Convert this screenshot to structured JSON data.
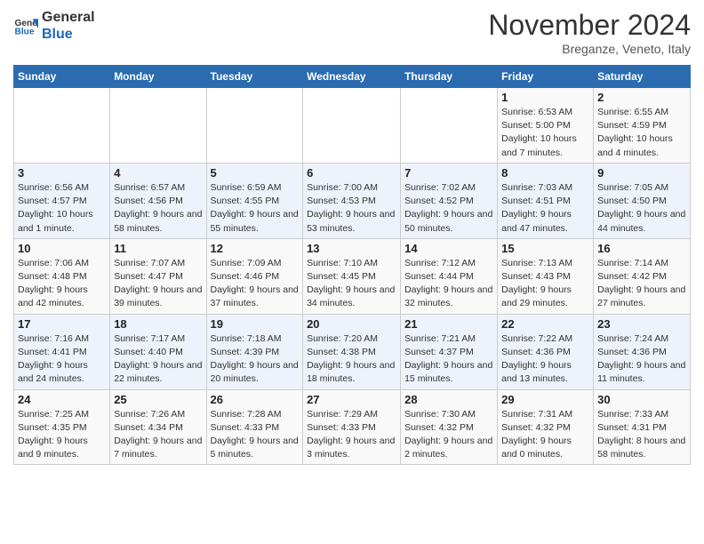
{
  "header": {
    "logo_line1": "General",
    "logo_line2": "Blue",
    "month": "November 2024",
    "location": "Breganze, Veneto, Italy"
  },
  "days_of_week": [
    "Sunday",
    "Monday",
    "Tuesday",
    "Wednesday",
    "Thursday",
    "Friday",
    "Saturday"
  ],
  "weeks": [
    [
      {
        "day": "",
        "info": ""
      },
      {
        "day": "",
        "info": ""
      },
      {
        "day": "",
        "info": ""
      },
      {
        "day": "",
        "info": ""
      },
      {
        "day": "",
        "info": ""
      },
      {
        "day": "1",
        "info": "Sunrise: 6:53 AM\nSunset: 5:00 PM\nDaylight: 10 hours and 7 minutes."
      },
      {
        "day": "2",
        "info": "Sunrise: 6:55 AM\nSunset: 4:59 PM\nDaylight: 10 hours and 4 minutes."
      }
    ],
    [
      {
        "day": "3",
        "info": "Sunrise: 6:56 AM\nSunset: 4:57 PM\nDaylight: 10 hours and 1 minute."
      },
      {
        "day": "4",
        "info": "Sunrise: 6:57 AM\nSunset: 4:56 PM\nDaylight: 9 hours and 58 minutes."
      },
      {
        "day": "5",
        "info": "Sunrise: 6:59 AM\nSunset: 4:55 PM\nDaylight: 9 hours and 55 minutes."
      },
      {
        "day": "6",
        "info": "Sunrise: 7:00 AM\nSunset: 4:53 PM\nDaylight: 9 hours and 53 minutes."
      },
      {
        "day": "7",
        "info": "Sunrise: 7:02 AM\nSunset: 4:52 PM\nDaylight: 9 hours and 50 minutes."
      },
      {
        "day": "8",
        "info": "Sunrise: 7:03 AM\nSunset: 4:51 PM\nDaylight: 9 hours and 47 minutes."
      },
      {
        "day": "9",
        "info": "Sunrise: 7:05 AM\nSunset: 4:50 PM\nDaylight: 9 hours and 44 minutes."
      }
    ],
    [
      {
        "day": "10",
        "info": "Sunrise: 7:06 AM\nSunset: 4:48 PM\nDaylight: 9 hours and 42 minutes."
      },
      {
        "day": "11",
        "info": "Sunrise: 7:07 AM\nSunset: 4:47 PM\nDaylight: 9 hours and 39 minutes."
      },
      {
        "day": "12",
        "info": "Sunrise: 7:09 AM\nSunset: 4:46 PM\nDaylight: 9 hours and 37 minutes."
      },
      {
        "day": "13",
        "info": "Sunrise: 7:10 AM\nSunset: 4:45 PM\nDaylight: 9 hours and 34 minutes."
      },
      {
        "day": "14",
        "info": "Sunrise: 7:12 AM\nSunset: 4:44 PM\nDaylight: 9 hours and 32 minutes."
      },
      {
        "day": "15",
        "info": "Sunrise: 7:13 AM\nSunset: 4:43 PM\nDaylight: 9 hours and 29 minutes."
      },
      {
        "day": "16",
        "info": "Sunrise: 7:14 AM\nSunset: 4:42 PM\nDaylight: 9 hours and 27 minutes."
      }
    ],
    [
      {
        "day": "17",
        "info": "Sunrise: 7:16 AM\nSunset: 4:41 PM\nDaylight: 9 hours and 24 minutes."
      },
      {
        "day": "18",
        "info": "Sunrise: 7:17 AM\nSunset: 4:40 PM\nDaylight: 9 hours and 22 minutes."
      },
      {
        "day": "19",
        "info": "Sunrise: 7:18 AM\nSunset: 4:39 PM\nDaylight: 9 hours and 20 minutes."
      },
      {
        "day": "20",
        "info": "Sunrise: 7:20 AM\nSunset: 4:38 PM\nDaylight: 9 hours and 18 minutes."
      },
      {
        "day": "21",
        "info": "Sunrise: 7:21 AM\nSunset: 4:37 PM\nDaylight: 9 hours and 15 minutes."
      },
      {
        "day": "22",
        "info": "Sunrise: 7:22 AM\nSunset: 4:36 PM\nDaylight: 9 hours and 13 minutes."
      },
      {
        "day": "23",
        "info": "Sunrise: 7:24 AM\nSunset: 4:36 PM\nDaylight: 9 hours and 11 minutes."
      }
    ],
    [
      {
        "day": "24",
        "info": "Sunrise: 7:25 AM\nSunset: 4:35 PM\nDaylight: 9 hours and 9 minutes."
      },
      {
        "day": "25",
        "info": "Sunrise: 7:26 AM\nSunset: 4:34 PM\nDaylight: 9 hours and 7 minutes."
      },
      {
        "day": "26",
        "info": "Sunrise: 7:28 AM\nSunset: 4:33 PM\nDaylight: 9 hours and 5 minutes."
      },
      {
        "day": "27",
        "info": "Sunrise: 7:29 AM\nSunset: 4:33 PM\nDaylight: 9 hours and 3 minutes."
      },
      {
        "day": "28",
        "info": "Sunrise: 7:30 AM\nSunset: 4:32 PM\nDaylight: 9 hours and 2 minutes."
      },
      {
        "day": "29",
        "info": "Sunrise: 7:31 AM\nSunset: 4:32 PM\nDaylight: 9 hours and 0 minutes."
      },
      {
        "day": "30",
        "info": "Sunrise: 7:33 AM\nSunset: 4:31 PM\nDaylight: 8 hours and 58 minutes."
      }
    ]
  ]
}
